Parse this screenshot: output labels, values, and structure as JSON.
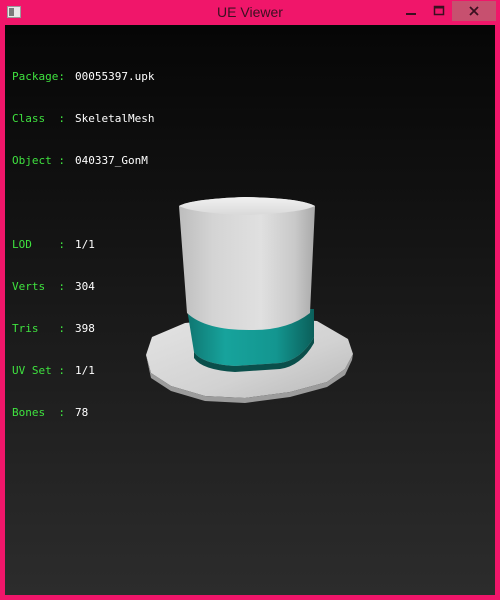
{
  "window": {
    "title": "UE Viewer",
    "icon": "app-icon",
    "controls": {
      "minimize": "minimize-icon",
      "maximize": "maximize-icon",
      "close": "close-icon"
    }
  },
  "info": {
    "package_label": "Package:",
    "package_value": "00055397.upk",
    "class_label": "Class  :",
    "class_value": "SkeletalMesh",
    "object_label": "Object :",
    "object_value": "040337_GonM",
    "lod_label": "LOD    :",
    "lod_value": "1/1",
    "verts_label": "Verts  :",
    "verts_value": "304",
    "tris_label": "Tris   :",
    "tris_value": "398",
    "uvset_label": "UV Set :",
    "uvset_value": "1/1",
    "bones_label": "Bones  :",
    "bones_value": "78"
  },
  "colors": {
    "frame": "#f0166a",
    "label": "#3fe23f",
    "value": "#ffffff",
    "hat_band": "#138f8a",
    "hat_body": "#d6d6d6"
  }
}
